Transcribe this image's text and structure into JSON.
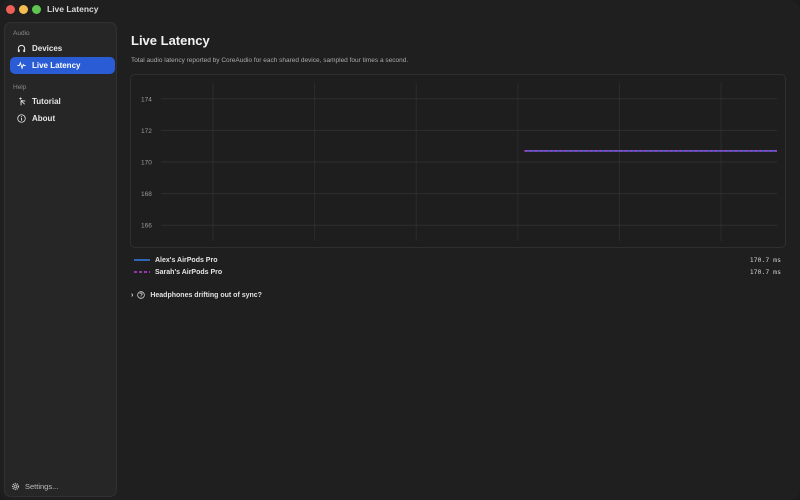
{
  "window": {
    "title": "Live Latency"
  },
  "sidebar": {
    "sections": [
      {
        "label": "Audio",
        "items": [
          {
            "label": "Devices",
            "icon": "headphones-icon"
          },
          {
            "label": "Live Latency",
            "icon": "waveform-icon",
            "active": true
          }
        ]
      },
      {
        "label": "Help",
        "items": [
          {
            "label": "Tutorial",
            "icon": "sparkle-pointer-icon"
          },
          {
            "label": "About",
            "icon": "info-icon"
          }
        ]
      }
    ],
    "settings_label": "Settings..."
  },
  "main": {
    "title": "Live Latency",
    "subtitle": "Total audio latency reported by CoreAudio for each shared device, sampled four times a second.",
    "disclosure_label": "Headphones drifting out of sync?"
  },
  "chart_data": {
    "type": "line",
    "ylim": [
      165,
      175
    ],
    "yticks": [
      "174",
      "172",
      "170",
      "168",
      "166"
    ],
    "ytick_values": [
      174,
      172,
      170,
      168,
      166
    ],
    "xlim": [
      0,
      100
    ],
    "grid": true,
    "series": [
      {
        "name": "Alex's AirPods Pro",
        "color": "#3b82f6",
        "dash": false,
        "x": [
          59,
          100
        ],
        "y": [
          170.7,
          170.7
        ],
        "current": "170.7 ms"
      },
      {
        "name": "Sarah's AirPods Pro",
        "color": "#c040e0",
        "dash": true,
        "x": [
          59,
          100
        ],
        "y": [
          170.7,
          170.7
        ],
        "current": "170.7 ms"
      }
    ]
  },
  "colors": {
    "accent": "#2a5cd6",
    "series_a": "#3b82f6",
    "series_b": "#c040e0"
  }
}
